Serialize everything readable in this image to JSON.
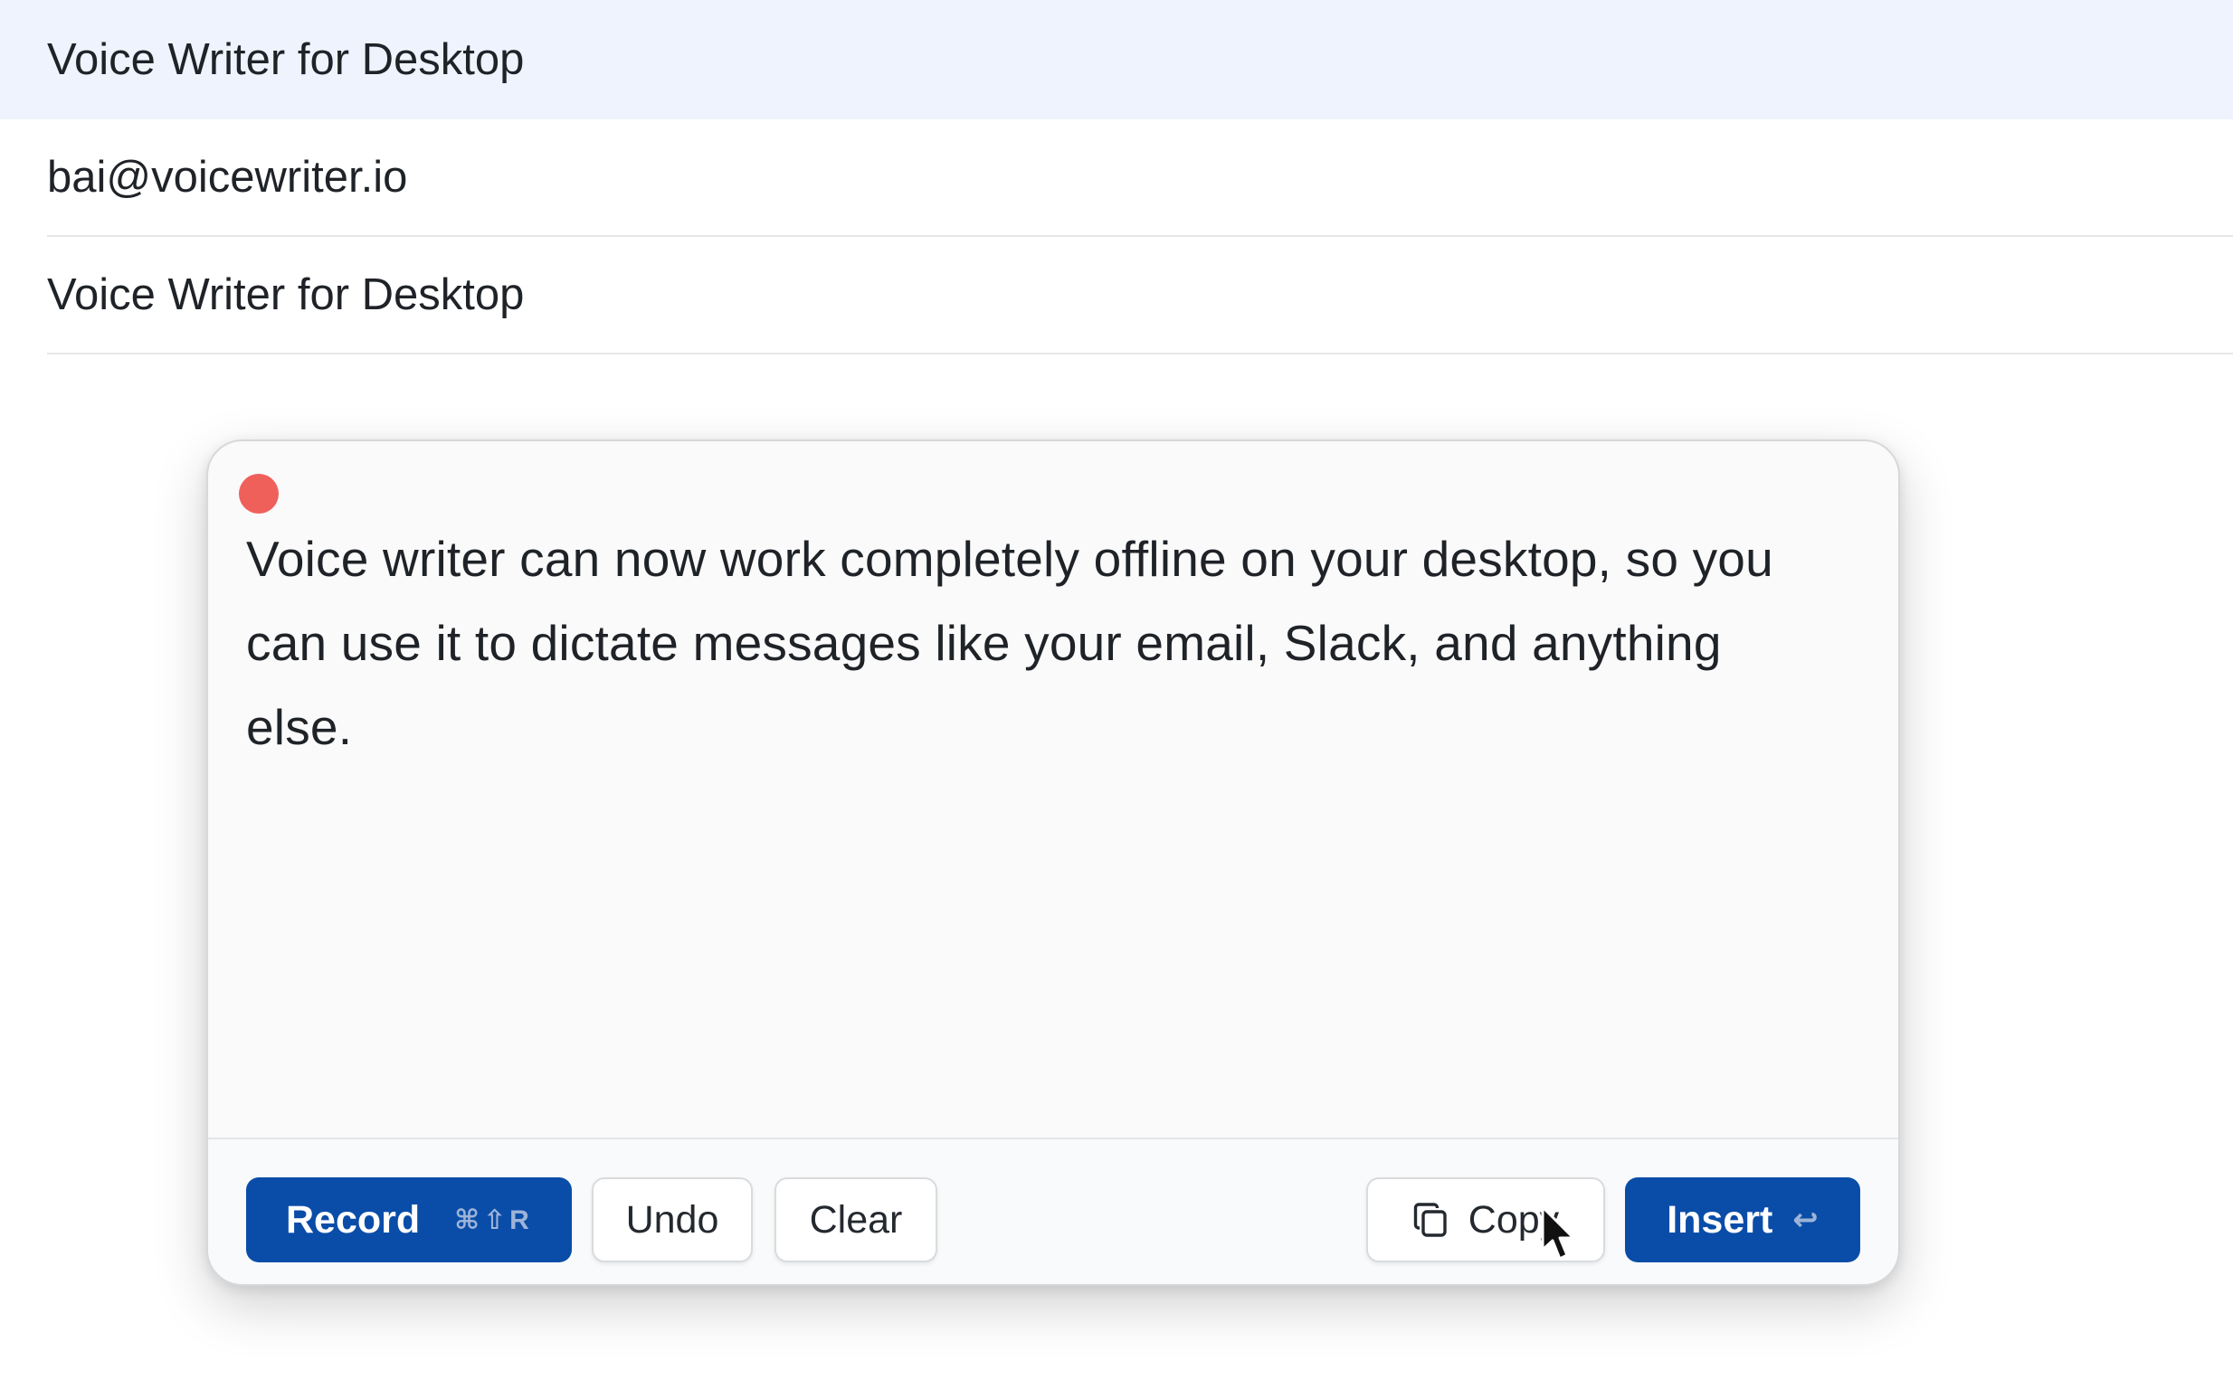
{
  "email": {
    "subject_row": "Voice Writer for Desktop",
    "to_row": "bai@voicewriter.io",
    "title_row": "Voice Writer for Desktop"
  },
  "popup": {
    "recording_indicator_color": "#f0605b",
    "transcript": "Voice writer can now work completely offline on your desktop, so you can use it to dictate messages like your email, Slack, and anything else.",
    "buttons": {
      "record_label": "Record",
      "record_shortcut": "⌘⇧R",
      "undo_label": "Undo",
      "clear_label": "Clear",
      "copy_label": "Copy",
      "insert_label": "Insert",
      "insert_shortcut": "↩"
    },
    "icons": {
      "copy": "copy-icon",
      "enter": "enter-icon",
      "cursor": "mouse-pointer-icon"
    },
    "colors": {
      "primary": "#0a4da8",
      "header_highlight": "#eef3fd"
    }
  }
}
